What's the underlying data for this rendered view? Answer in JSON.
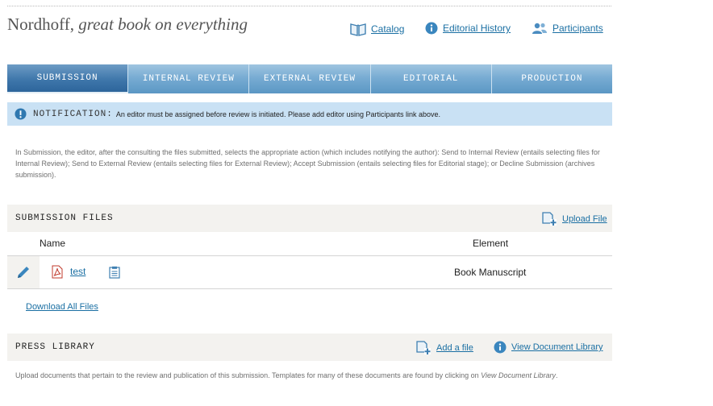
{
  "header": {
    "title_author": "Nordhoff,",
    "title_book": "great book on everything",
    "links": {
      "catalog": "Catalog",
      "editorial_history": "Editorial History",
      "participants": "Participants"
    }
  },
  "tabs": [
    "SUBMISSION",
    "INTERNAL REVIEW",
    "EXTERNAL REVIEW",
    "EDITORIAL",
    "PRODUCTION"
  ],
  "active_tab": "SUBMISSION",
  "notification": {
    "label": "NOTIFICATION:",
    "message": "An editor must be assigned before review is initiated. Please add editor using Participants link above."
  },
  "intro_text": "In Submission, the editor, after the consulting the files submitted, selects the appropriate action (which includes notifying the author): Send to Internal Review (entails selecting files for Internal Review); Send to External Review (entails selecting files for External Review); Accept Submission (entails selecting files for Editorial stage); or Decline Submission (archives submission).",
  "submission_files": {
    "title": "SUBMISSION FILES",
    "upload_label": "Upload File",
    "columns": {
      "name": "Name",
      "element": "Element"
    },
    "rows": [
      {
        "name": "test",
        "element": "Book Manuscript"
      }
    ],
    "download_all": "Download All Files"
  },
  "press_library": {
    "title": "PRESS LIBRARY",
    "add_label": "Add a file",
    "view_label": "View Document Library",
    "text_main": "Upload documents that pertain to the review and publication of this submission. Templates for many of these documents are found by clicking on ",
    "text_link": "View Document Library",
    "text_end": "."
  },
  "colors": {
    "link": "#1a6fa3",
    "tab_active": "#2d659b",
    "tab": "#78acd3",
    "notification_bg": "#c9e1f4",
    "section_bg": "#f3f2ef"
  }
}
